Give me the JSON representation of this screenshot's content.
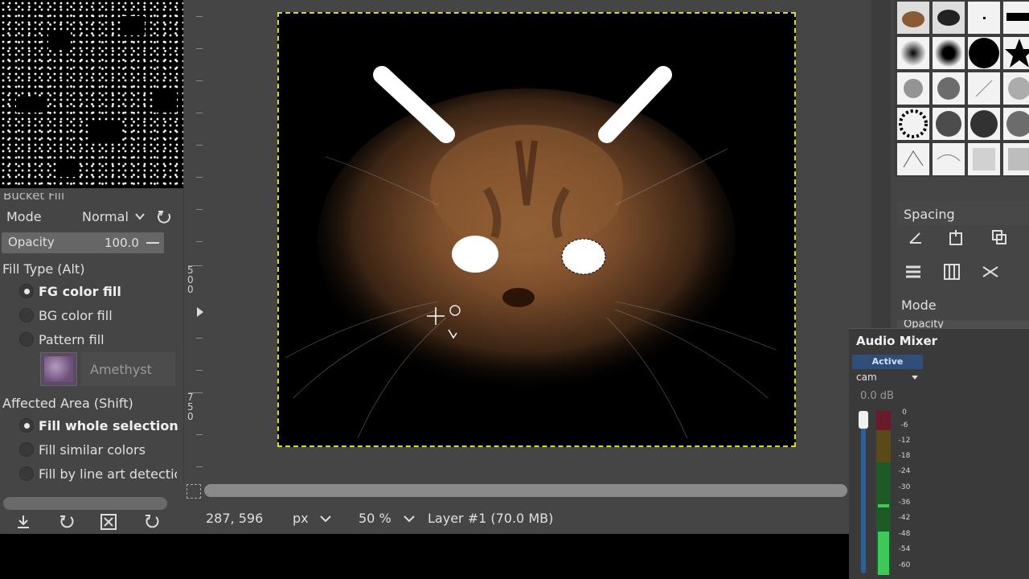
{
  "tool_options": {
    "title": "Bucket Fill",
    "mode_label": "Mode",
    "mode_value": "Normal",
    "opacity_label": "Opacity",
    "opacity_value": "100.0",
    "fill_type_label": "Fill Type  (Alt)",
    "fill_types": [
      "FG color fill",
      "BG color fill",
      "Pattern fill"
    ],
    "fill_type_selected": 0,
    "pattern_name": "Amethyst",
    "affected_area_label": "Affected Area  (Shift)",
    "affected_areas": [
      "Fill whole selection",
      "Fill similar colors",
      "Fill by line art detection"
    ],
    "affected_area_selected": 0
  },
  "ruler": {
    "labels": [
      "5",
      "0",
      "0",
      "7",
      "5",
      "0"
    ]
  },
  "status_bar": {
    "coordinates": "287, 596",
    "unit": "px",
    "zoom": "50 %",
    "layer_info": "Layer #1 (70.0 MB)"
  },
  "right_panel": {
    "spacing_label": "Spacing",
    "mode_label": "Mode",
    "opacity_label": "Opacity"
  },
  "audio_mixer": {
    "title": "Audio Mixer",
    "tab_active": "Active",
    "source": "cam",
    "level": "0.0 dB",
    "scale": [
      "0",
      "-6",
      "-12",
      "-18",
      "-24",
      "-30",
      "-36",
      "-42",
      "-48",
      "-54",
      "-60"
    ]
  },
  "colors": {
    "accent": "#3c6ea5",
    "selection_marching_ants": "#d8d83a",
    "meter_green": "#2fa84a",
    "meter_red": "#8a2230"
  }
}
